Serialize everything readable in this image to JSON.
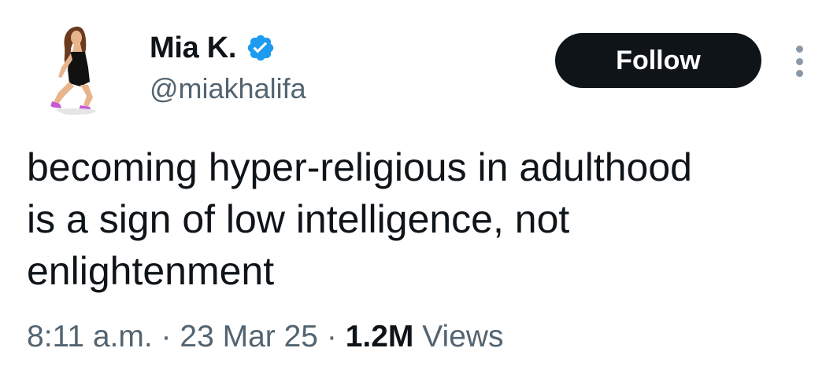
{
  "author": {
    "display_name": "Mia K.",
    "handle": "@miakhalifa",
    "verified": true,
    "verified_color": "#1d9bf0"
  },
  "actions": {
    "follow_label": "Follow",
    "more_icon": "more-vertical-icon"
  },
  "tweet": {
    "text_lines": [
      "becoming hyper-religious in adulthood",
      "is a sign of low intelligence, not",
      "enlightenment"
    ]
  },
  "meta": {
    "time": "8:11 a.m.",
    "separator": "·",
    "date": "23 Mar 25",
    "views_count": "1.2M",
    "views_label": "Views"
  },
  "colors": {
    "text_primary": "#0f1419",
    "text_secondary": "#536471",
    "button_bg": "#0f1419",
    "button_text": "#ffffff"
  }
}
